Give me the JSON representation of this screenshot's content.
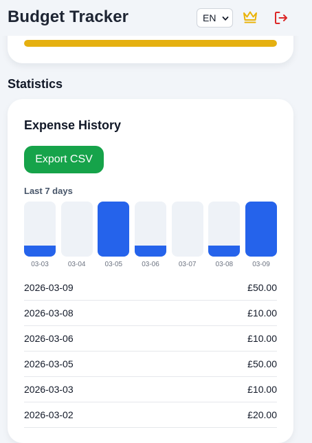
{
  "header": {
    "title": "Budget Tracker",
    "language": "EN",
    "premium_icon": "crown-icon",
    "logout_icon": "logout-icon",
    "colors": {
      "crown": "#eab308",
      "logout": "#dc2626"
    }
  },
  "top_card": {
    "progress_fraction": 1.0,
    "progress_color": "#e5b010"
  },
  "statistics": {
    "section_title": "Statistics",
    "card_title": "Expense History",
    "export_label": "Export CSV",
    "chart_label": "Last 7 days"
  },
  "chart_data": {
    "type": "bar",
    "categories": [
      "03-03",
      "03-04",
      "03-05",
      "03-06",
      "03-07",
      "03-08",
      "03-09"
    ],
    "values": [
      10,
      0,
      50,
      10,
      0,
      10,
      50
    ],
    "ylim": [
      0,
      50
    ],
    "title": "Last 7 days",
    "xlabel": "",
    "ylabel": ""
  },
  "history": [
    {
      "date": "2026-03-09",
      "amount": "£50.00"
    },
    {
      "date": "2026-03-08",
      "amount": "£10.00"
    },
    {
      "date": "2026-03-06",
      "amount": "£10.00"
    },
    {
      "date": "2026-03-05",
      "amount": "£50.00"
    },
    {
      "date": "2026-03-03",
      "amount": "£10.00"
    },
    {
      "date": "2026-03-02",
      "amount": "£20.00"
    }
  ]
}
